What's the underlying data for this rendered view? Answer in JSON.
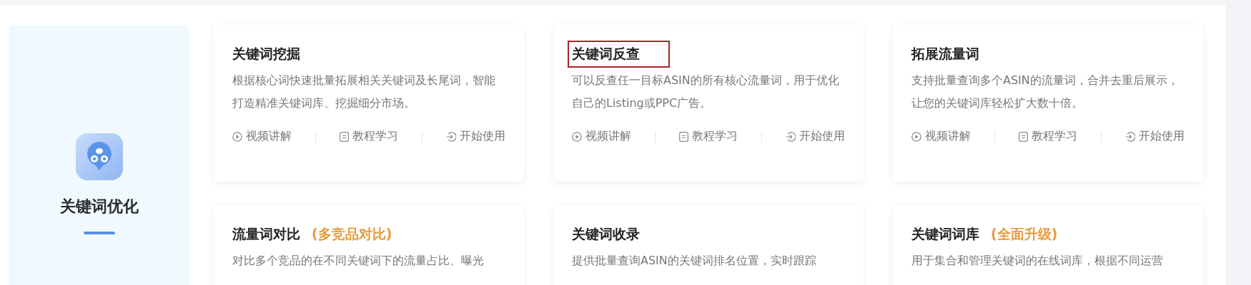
{
  "category": {
    "title": "关键词优化"
  },
  "cards": [
    {
      "title": "关键词挖掘",
      "highlighted": false,
      "description": "根据核心词快速批量拓展相关关键词及长尾词，智能打造精准关键词库、挖掘细分市场。",
      "actions": [
        {
          "kind": "video",
          "label": "视频讲解"
        },
        {
          "kind": "tutorial",
          "label": "教程学习"
        },
        {
          "kind": "start",
          "label": "开始使用"
        }
      ]
    },
    {
      "title": "关键词反查",
      "highlighted": true,
      "description": "可以反查任一目标ASIN的所有核心流量词，用于优化自己的Listing或PPC广告。",
      "actions": [
        {
          "kind": "video",
          "label": "视频讲解"
        },
        {
          "kind": "tutorial",
          "label": "教程学习"
        },
        {
          "kind": "start",
          "label": "开始使用"
        }
      ]
    },
    {
      "title": "拓展流量词",
      "highlighted": false,
      "description": "支持批量查询多个ASIN的流量词，合并去重后展示，让您的关键词库轻松扩大数十倍。",
      "actions": [
        {
          "kind": "video",
          "label": "视频讲解"
        },
        {
          "kind": "tutorial",
          "label": "教程学习"
        },
        {
          "kind": "start",
          "label": "开始使用"
        }
      ]
    },
    {
      "title": "流量词对比",
      "tag": "(多竞品对比)",
      "highlighted": false,
      "description": "对比多个竞品的在不同关键词下的流量占比、曝光"
    },
    {
      "title": "关键词收录",
      "highlighted": false,
      "description": "提供批量查询ASIN的关键词排名位置，实时跟踪"
    },
    {
      "title": "关键词词库",
      "tag": "(全面升级)",
      "highlighted": false,
      "description": "用于集合和管理关键词的在线词库，根据不同运营"
    }
  ]
}
